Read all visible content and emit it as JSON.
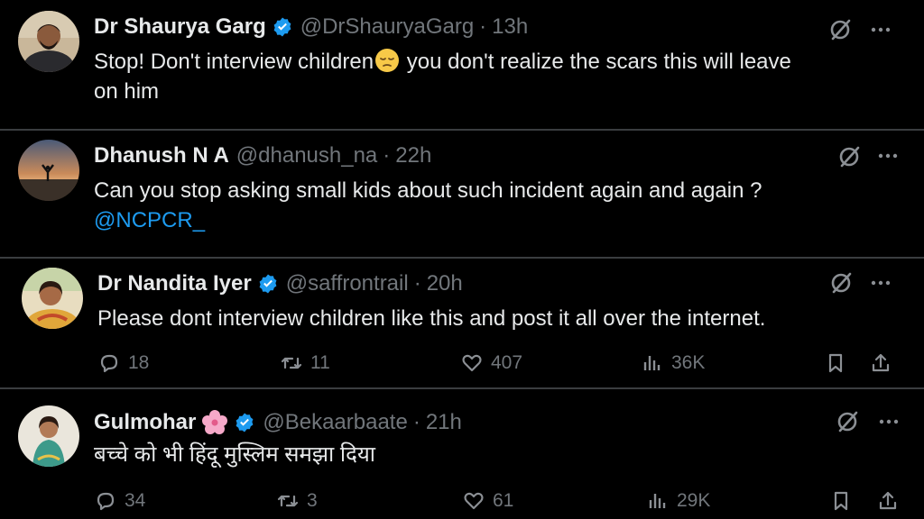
{
  "tweets": [
    {
      "name": "Dr Shaurya Garg",
      "handle": "@DrShauryaGarg",
      "dot": "·",
      "time": "13h",
      "text_before_emoji": "Stop! Don't interview children",
      "emoji": "pensive-face",
      "text_after_emoji": " you don't realize the scars this will leave",
      "text_line2": "on him",
      "verified": true
    },
    {
      "name": "Dhanush N A",
      "handle": "@dhanush_na",
      "dot": "·",
      "time": "22h",
      "text": "Can you stop asking small kids about such incident again and again ?",
      "mention": "@NCPCR_",
      "verified": false
    },
    {
      "name": "Dr Nandita Iyer",
      "handle": "@saffrontrail",
      "dot": "·",
      "time": "20h",
      "text": "Please dont interview children like this and post it all over the internet.",
      "verified": true,
      "replies": "18",
      "reposts": "11",
      "likes": "407",
      "views": "36K"
    },
    {
      "name": "Gulmohar",
      "handle": "@Bekaarbaate",
      "dot": "·",
      "time": "21h",
      "text": "बच्चे को भी हिंदू मुस्लिम समझा दिया",
      "verified": true,
      "badge_emoji": "cherry-blossom",
      "replies": "34",
      "reposts": "3",
      "likes": "61",
      "views": "29K"
    }
  ],
  "icons": {
    "verified": "verified-badge-icon",
    "grok": "grok-icon",
    "more": "more-icon",
    "reply": "reply-icon",
    "repost": "repost-icon",
    "like": "like-icon",
    "views": "views-icon",
    "bookmark": "bookmark-icon",
    "share": "share-icon"
  },
  "colors": {
    "background": "#000000",
    "text": "#e7e9ea",
    "muted": "#71767b",
    "accent": "#1d9bf0",
    "separator": "#3a3d40"
  }
}
